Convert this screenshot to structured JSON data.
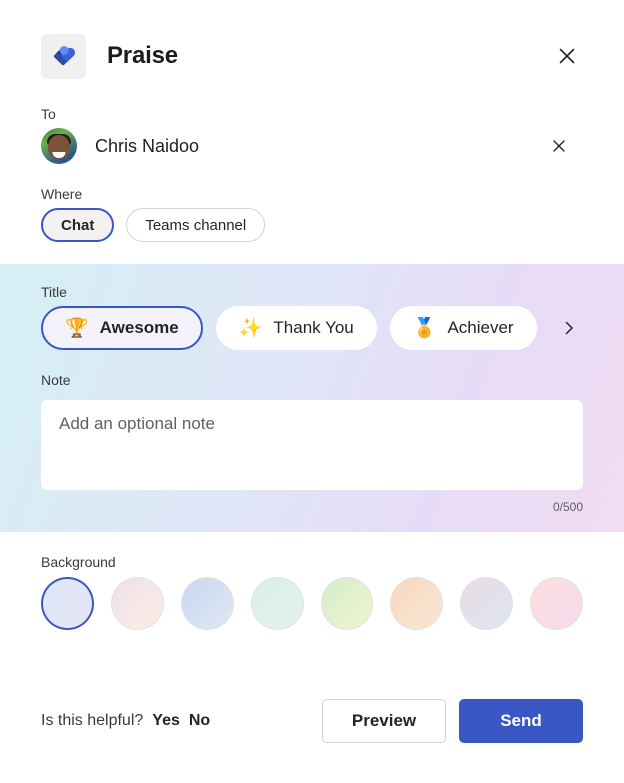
{
  "header": {
    "app_name": "Praise",
    "app_icon": "praise-heart-icon",
    "close_icon": "close-icon"
  },
  "recipient": {
    "label": "To",
    "name": "Chris Naidoo",
    "remove_icon": "close-icon"
  },
  "where": {
    "label": "Where",
    "options": [
      {
        "label": "Chat",
        "selected": true
      },
      {
        "label": "Teams channel",
        "selected": false
      }
    ]
  },
  "title": {
    "label": "Title",
    "options": [
      {
        "label": "Awesome",
        "emoji": "🏆",
        "icon": "trophy-icon",
        "selected": true
      },
      {
        "label": "Thank You",
        "emoji": "✨",
        "icon": "sparkles-icon",
        "selected": false
      },
      {
        "label": "Achiever",
        "emoji": "🏅",
        "icon": "medal-icon",
        "selected": false
      }
    ],
    "next_icon": "chevron-right-icon"
  },
  "note": {
    "label": "Note",
    "value": "",
    "placeholder": "Add an optional note",
    "char_count": "0/500",
    "max_length": 500
  },
  "background": {
    "label": "Background",
    "swatches": [
      {
        "name": "lavender-blue",
        "from": "#dbeaf7",
        "to": "#e9e2f7",
        "selected": true
      },
      {
        "name": "pink-peach",
        "from": "#efdfec",
        "to": "#fbeee2",
        "selected": false
      },
      {
        "name": "blue-periwinkle",
        "from": "#c9d8f0",
        "to": "#dfe7f3",
        "selected": false
      },
      {
        "name": "mint-teal",
        "from": "#d9efe9",
        "to": "#e3f2ea",
        "selected": false
      },
      {
        "name": "green-lime",
        "from": "#d5ecc9",
        "to": "#eff4d2",
        "selected": false
      },
      {
        "name": "orange-peach",
        "from": "#f6d9bf",
        "to": "#fae6d5",
        "selected": false
      },
      {
        "name": "mauve-steel",
        "from": "#e9dce7",
        "to": "#dde5ef",
        "selected": false
      },
      {
        "name": "blush-pink",
        "from": "#fbe0dd",
        "to": "#f6d8ee",
        "selected": false
      }
    ]
  },
  "footer": {
    "helpful_question": "Is this helpful?",
    "yes_label": "Yes",
    "no_label": "No",
    "preview_label": "Preview",
    "send_label": "Send"
  },
  "colors": {
    "accent": "#3a56c5",
    "band_from": "#d6f0f5",
    "band_to": "#f1dcf3"
  }
}
